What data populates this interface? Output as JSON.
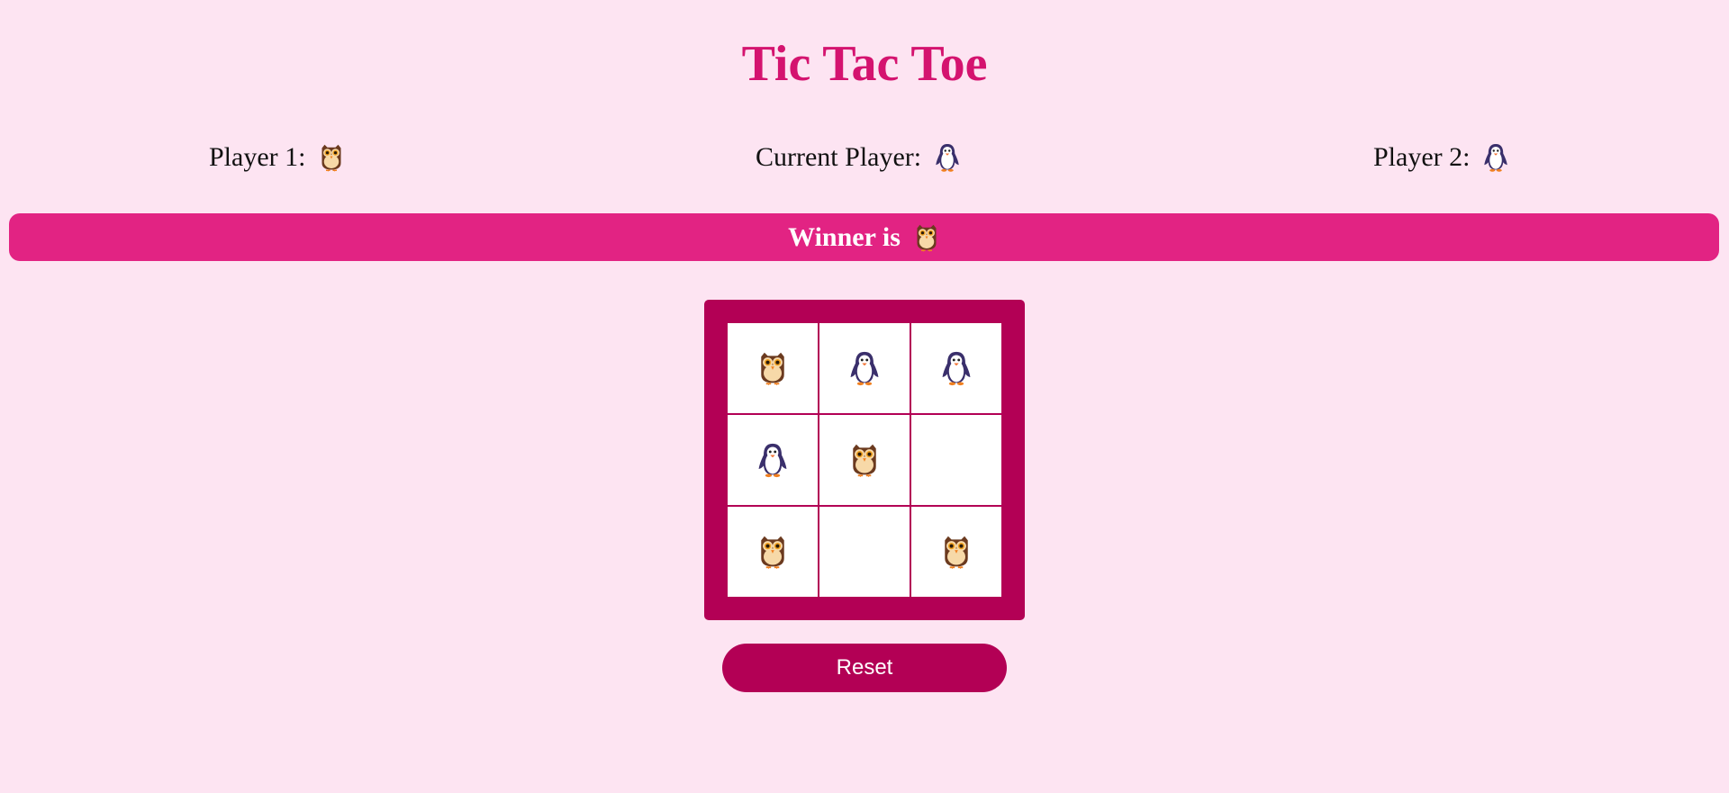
{
  "title": "Tic Tac Toe",
  "players": {
    "player1": {
      "label": "Player 1:",
      "icon": "owl-icon"
    },
    "current": {
      "label": "Current Player:",
      "icon": "penguin-icon"
    },
    "player2": {
      "label": "Player 2:",
      "icon": "penguin-icon"
    }
  },
  "winner": {
    "label": "Winner is",
    "icon": "owl-icon"
  },
  "board": [
    "owl",
    "penguin",
    "penguin",
    "penguin",
    "owl",
    "",
    "owl",
    "",
    "owl"
  ],
  "reset_label": "Reset",
  "colors": {
    "background": "#fde4f2",
    "title": "#d4136f",
    "winner_bar": "#e22383",
    "board": "#b30055",
    "button": "#b30055"
  }
}
